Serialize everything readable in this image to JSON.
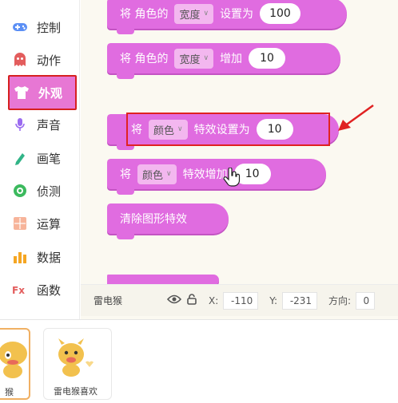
{
  "sidebar": {
    "items": [
      {
        "label": "控制",
        "icon": "gamepad-icon",
        "color": "#5b8ff5"
      },
      {
        "label": "动作",
        "icon": "ghost-icon",
        "color": "#e35d5d"
      },
      {
        "label": "外观",
        "icon": "tshirt-icon",
        "color": "#ffffff",
        "active": true
      },
      {
        "label": "声音",
        "icon": "microphone-icon",
        "color": "#9b6cf0"
      },
      {
        "label": "画笔",
        "icon": "pen-icon",
        "color": "#31b487"
      },
      {
        "label": "侦测",
        "icon": "radar-icon",
        "color": "#3cba5e"
      },
      {
        "label": "运算",
        "icon": "calculator-icon",
        "color": "#f09a78"
      },
      {
        "label": "数据",
        "icon": "chart-icon",
        "color": "#f5a623"
      },
      {
        "label": "函数",
        "icon": "function-icon",
        "color": "#e35d5d"
      }
    ]
  },
  "blocks": {
    "b1": {
      "t1": "将 角色的",
      "dd": "宽度",
      "t2": "设置为",
      "value": "100"
    },
    "b2": {
      "t1": "将 角色的",
      "dd": "宽度",
      "t2": "增加",
      "value": "10"
    },
    "b3": {
      "t1": "将",
      "dd": "颜色",
      "t2": "特效设置为",
      "value": "10"
    },
    "b4": {
      "t1": "将",
      "dd": "颜色",
      "t2": "特效增加",
      "value": "10"
    },
    "b5": {
      "t1": "清除图形特效"
    }
  },
  "coordbar": {
    "sprite_name": "雷电猴",
    "x_label": "X:",
    "x_value": "-110",
    "y_label": "Y:",
    "y_value": "-231",
    "dir_label": "方向:",
    "dir_value": "0"
  },
  "sprites": [
    {
      "name": "猴",
      "selected": true
    },
    {
      "name": "雷电猴喜欢",
      "selected": false
    }
  ],
  "colors": {
    "block": "#e06ce0",
    "active_category": "#e777d4",
    "highlight": "#e02222"
  }
}
